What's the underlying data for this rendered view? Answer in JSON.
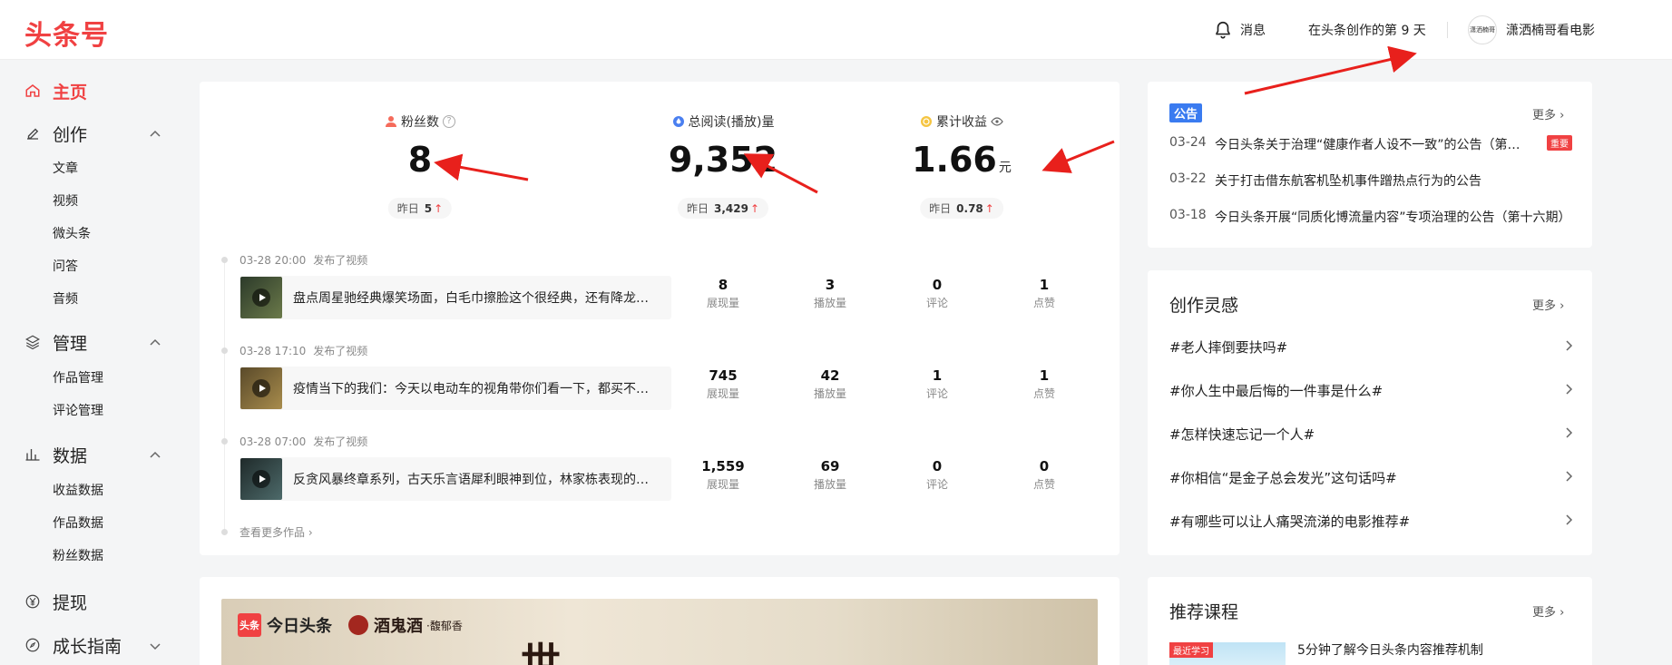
{
  "app": {
    "logo": "头条号"
  },
  "header": {
    "messages_label": "消息",
    "days_text": "在头条创作的第 9 天",
    "user_name": "潇洒楠哥看电影",
    "avatar_text": "潇洒楠哥"
  },
  "sidebar": {
    "home": "主页",
    "create": "创作",
    "create_items": [
      "文章",
      "视频",
      "微头条",
      "问答",
      "音频"
    ],
    "manage": "管理",
    "manage_items": [
      "作品管理",
      "评论管理"
    ],
    "data": "数据",
    "data_items": [
      "收益数据",
      "作品数据",
      "粉丝数据"
    ],
    "withdraw": "提现",
    "growth": "成长指南"
  },
  "stats": {
    "fans": {
      "label": "粉丝数",
      "value": "8",
      "yday_label": "昨日",
      "yday_value": "5"
    },
    "reads": {
      "label": "总阅读(播放)量",
      "value": "9,352",
      "yday_label": "昨日",
      "yday_value": "3,429"
    },
    "income": {
      "label": "累计收益",
      "value": "1.66",
      "unit": "元",
      "yday_label": "昨日",
      "yday_value": "0.78"
    }
  },
  "works": [
    {
      "time": "03-28 20:00",
      "action": "发布了视频",
      "title": "盘点周星驰经典爆笑场面，白毛巾擦脸这个很经典，还有降龙十八掌",
      "metrics": [
        {
          "n": "8",
          "l": "展现量"
        },
        {
          "n": "3",
          "l": "播放量"
        },
        {
          "n": "0",
          "l": "评论"
        },
        {
          "n": "1",
          "l": "点赞"
        }
      ]
    },
    {
      "time": "03-28 17:10",
      "action": "发布了视频",
      "title": "疫情当下的我们：今天以电动车的视角带你们看一下，都买不到东西",
      "metrics": [
        {
          "n": "745",
          "l": "展现量"
        },
        {
          "n": "42",
          "l": "播放量"
        },
        {
          "n": "1",
          "l": "评论"
        },
        {
          "n": "1",
          "l": "点赞"
        }
      ]
    },
    {
      "time": "03-28 07:00",
      "action": "发布了视频",
      "title": "反贪风暴终章系列，古天乐言语犀利眼神到位，林家栋表现的很好",
      "metrics": [
        {
          "n": "1,559",
          "l": "展现量"
        },
        {
          "n": "69",
          "l": "播放量"
        },
        {
          "n": "0",
          "l": "评论"
        },
        {
          "n": "0",
          "l": "点赞"
        }
      ]
    }
  ],
  "more_works": "查看更多作品",
  "banner": {
    "brand1": "今日头条",
    "brand1_logo": "头条",
    "brand2": "酒鬼酒",
    "brand2_sub": "·馥郁香",
    "headline": "世"
  },
  "notice": {
    "tag": "公告",
    "more": "更多",
    "items": [
      {
        "date": "03-24",
        "text": "今日头条关于治理“健康作者人设不一致”的公告（第一期）",
        "badge": "重要"
      },
      {
        "date": "03-22",
        "text": "关于打击借东航客机坠机事件蹭热点行为的公告"
      },
      {
        "date": "03-18",
        "text": "今日头条开展“同质化博流量内容”专项治理的公告（第十六期）"
      }
    ]
  },
  "inspiration": {
    "title": "创作灵感",
    "more": "更多",
    "topics": [
      "#老人摔倒要扶吗#",
      "#你人生中最后悔的一件事是什么#",
      "#怎样快速忘记一个人#",
      "#你相信“是金子总会发光”这句话吗#",
      "#有哪些可以让人痛哭流涕的电影推荐#"
    ]
  },
  "courses": {
    "title": "推荐课程",
    "more": "更多",
    "tag": "最近学习",
    "item_title": "5分钟了解今日头条内容推荐机制"
  },
  "colors": {
    "brand": "#f04142",
    "accent_blue": "#3a7bf0"
  }
}
